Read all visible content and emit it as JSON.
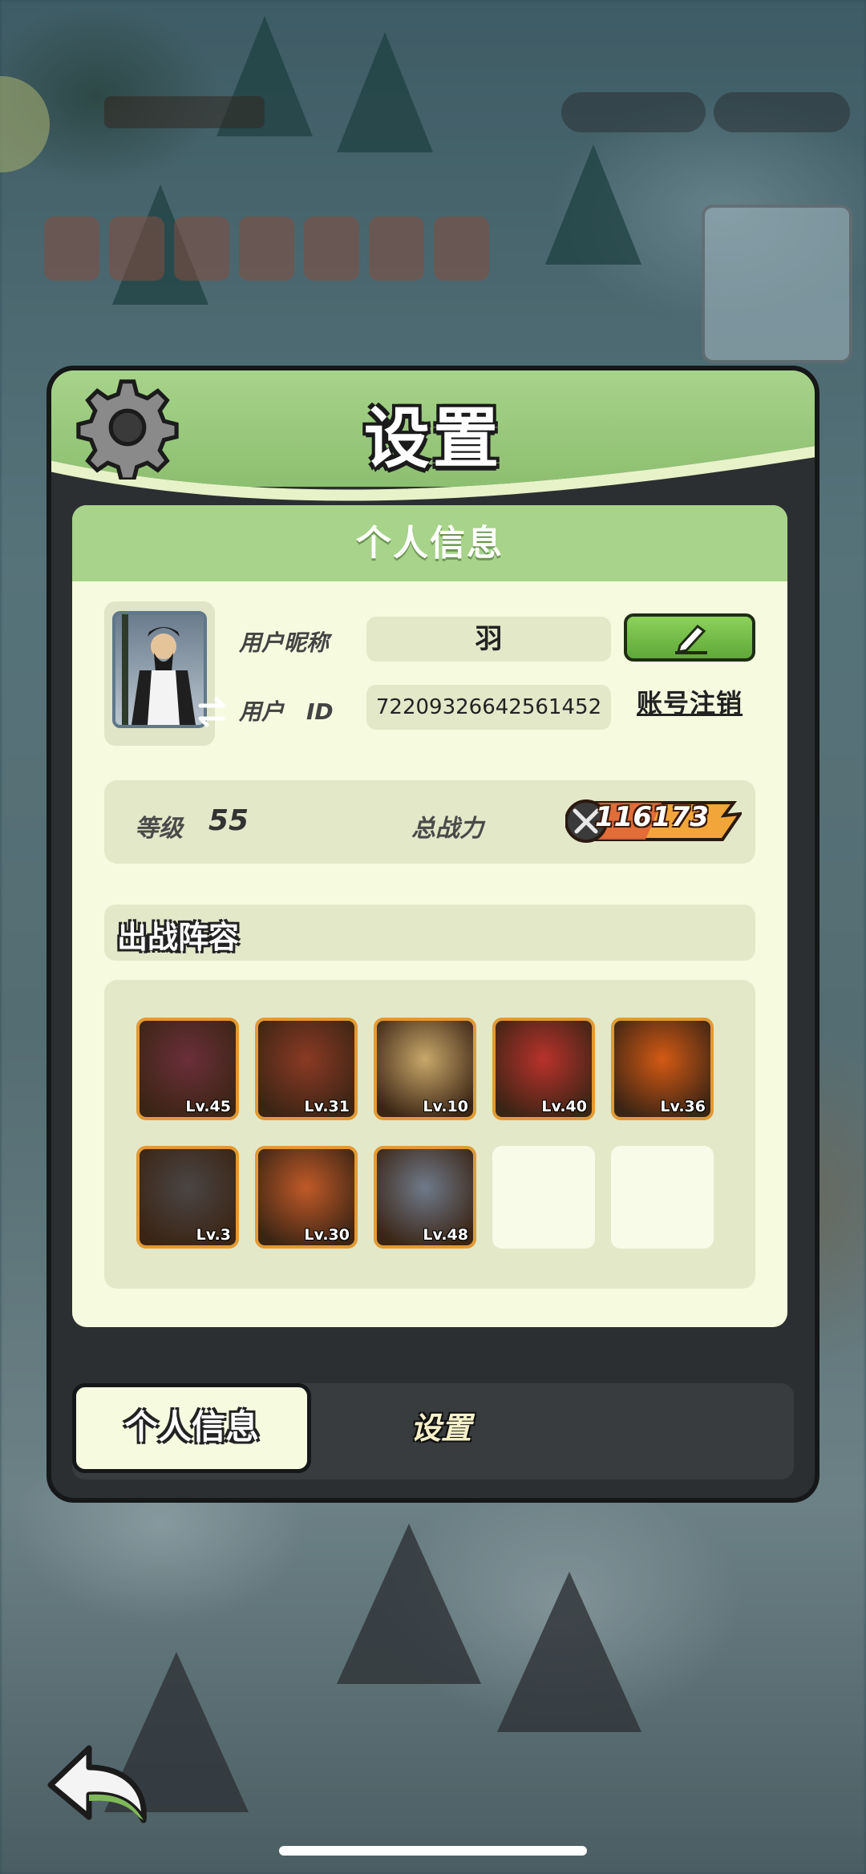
{
  "panel": {
    "title": "设置"
  },
  "profile": {
    "section_title": "个人信息",
    "nickname_label": "用户昵称",
    "nickname_value": "羽",
    "id_label": "用户　ID",
    "id_value": "72209326642561452",
    "delete_account_label": "账号注销",
    "level_label": "等级",
    "level_value": "55",
    "power_label": "总战力",
    "power_value": "116173"
  },
  "lineup": {
    "title": "出战阵容",
    "heroes": [
      {
        "level": "Lv.45",
        "color": "#6b2f3a"
      },
      {
        "level": "Lv.31",
        "color": "#8a3a24"
      },
      {
        "level": "Lv.10",
        "color": "#c9a86a"
      },
      {
        "level": "Lv.40",
        "color": "#b8322c"
      },
      {
        "level": "Lv.36",
        "color": "#d35a14"
      },
      {
        "level": "Lv.3",
        "color": "#4a4544"
      },
      {
        "level": "Lv.30",
        "color": "#c05a28"
      },
      {
        "level": "Lv.48",
        "color": "#6f7a8a"
      },
      {
        "level": "",
        "color": ""
      },
      {
        "level": "",
        "color": ""
      }
    ]
  },
  "tabs": {
    "active": "个人信息",
    "inactive": "设置"
  },
  "colors": {
    "accent_green": "#a7d38a",
    "panel_dark": "#2c2f31",
    "card_bg": "#f6fbe0",
    "hero_frame": "#e29a33"
  },
  "icons": [
    "gear-icon",
    "swap-icon",
    "pencil-icon",
    "sword-icon",
    "back-arrow-icon"
  ]
}
